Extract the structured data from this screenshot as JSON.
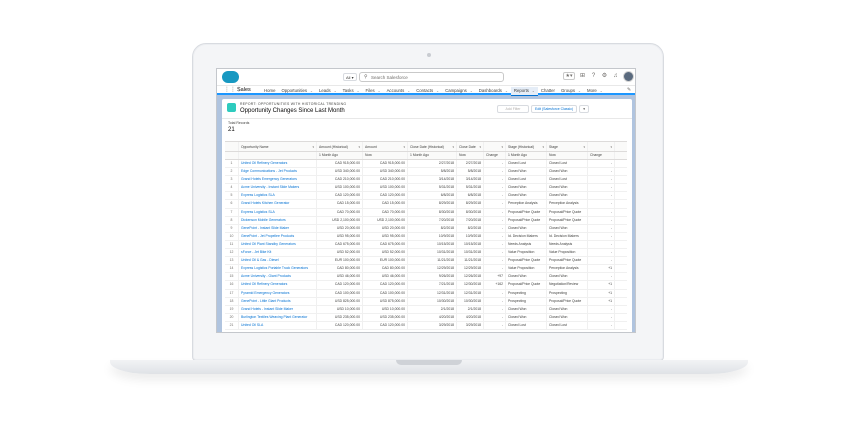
{
  "topbar": {
    "scope": "All",
    "search_placeholder": "Search Salesforce"
  },
  "nav": {
    "app_name": "Sales",
    "items": [
      {
        "label": "Home",
        "has_menu": false
      },
      {
        "label": "Opportunities",
        "has_menu": true
      },
      {
        "label": "Leads",
        "has_menu": true
      },
      {
        "label": "Tasks",
        "has_menu": true
      },
      {
        "label": "Files",
        "has_menu": true
      },
      {
        "label": "Accounts",
        "has_menu": true
      },
      {
        "label": "Contacts",
        "has_menu": true
      },
      {
        "label": "Campaigns",
        "has_menu": true
      },
      {
        "label": "Dashboards",
        "has_menu": true
      },
      {
        "label": "Reports",
        "has_menu": true,
        "active": true
      },
      {
        "label": "Chatter",
        "has_menu": false
      },
      {
        "label": "Groups",
        "has_menu": true
      },
      {
        "label": "More",
        "has_menu": true
      }
    ]
  },
  "report": {
    "type_label": "REPORT: OPPORTUNITIES WITH HISTORICAL TRENDING",
    "title": "Opportunity Changes Since Last Month",
    "add_filter": "Add Filter",
    "edit_button": "Edit (Salesforce Classic)",
    "total_label": "Total Records",
    "total_value": "21"
  },
  "table": {
    "headers": [
      "Opportunity Name",
      "Amount (Historical)",
      "Amount",
      "Close Date (Historical)",
      "Close Date",
      "",
      "Stage (Historical)",
      "Stage",
      ""
    ],
    "subheaders": [
      "",
      "1 Month Ago",
      "Now",
      "1 Month Ago",
      "Now",
      "Change",
      "1 Month Ago",
      "Now",
      "Change"
    ],
    "rows": [
      [
        "1",
        "United Oil Refinery Generators",
        "CAD 915,000.00",
        "CAD 915,000.00",
        "2/27/2018",
        "2/27/2018",
        "-",
        "Closed Lost",
        "Closed Lost",
        "-"
      ],
      [
        "2",
        "Edge Communications - Jet Products",
        "USD 340,000.00",
        "USD 340,000.00",
        "5/8/2018",
        "5/8/2018",
        "-",
        "Closed Won",
        "Closed Won",
        "-"
      ],
      [
        "3",
        "Grand Hotels Emergency Generators",
        "CAD 210,000.00",
        "CAD 210,000.00",
        "3/14/2018",
        "3/14/2018",
        "-",
        "Closed Lost",
        "Closed Lost",
        "-"
      ],
      [
        "4",
        "Acme University - Instant Slide Makers",
        "USD 100,000.00",
        "USD 100,000.00",
        "5/31/2018",
        "5/31/2018",
        "-",
        "Closed Won",
        "Closed Won",
        "-"
      ],
      [
        "5",
        "Express Logistics SLA",
        "CAD 120,000.00",
        "CAD 120,000.00",
        "6/8/2018",
        "6/8/2018",
        "-",
        "Closed Won",
        "Closed Won",
        "-"
      ],
      [
        "6",
        "Grand Hotels Kitchen Generator",
        "CAD 15,000.00",
        "CAD 15,000.00",
        "8/29/2018",
        "8/29/2018",
        "-",
        "Perception Analysis",
        "Perception Analysis",
        "-"
      ],
      [
        "7",
        "Express Logistics SLA",
        "CAD 70,000.00",
        "CAD 70,000.00",
        "8/30/2018",
        "8/30/2018",
        "-",
        "Proposal/Price Quote",
        "Proposal/Price Quote",
        "-"
      ],
      [
        "8",
        "Dickenson Mobile Generators",
        "USD 2,100,000.00",
        "USD 2,100,000.00",
        "7/20/2018",
        "7/20/2018",
        "-",
        "Proposal/Price Quote",
        "Proposal/Price Quote",
        "-"
      ],
      [
        "9",
        "GenePoint - Instant Slide Maker",
        "USD 20,000.00",
        "USD 20,000.00",
        "8/2/2018",
        "8/2/2018",
        "-",
        "Closed Won",
        "Closed Won",
        "-"
      ],
      [
        "10",
        "GenePoint - Jet Propellee Products",
        "USD 95,000.00",
        "USD 95,000.00",
        "10/9/2018",
        "10/9/2018",
        "-",
        "Id. Decision Makers",
        "Id. Decision Makers",
        "-"
      ],
      [
        "11",
        "United Oil Plant Standby Generators",
        "CAD 675,000.00",
        "CAD 675,000.00",
        "10/15/2018",
        "10/15/2018",
        "-",
        "Needs Analysis",
        "Needs Analysis",
        "-"
      ],
      [
        "12",
        "sForce - Jet Bike Kit",
        "USD 52,000.00",
        "USD 52,000.00",
        "10/31/2018",
        "10/31/2018",
        "-",
        "Value Proposition",
        "Value Proposition",
        "-"
      ],
      [
        "13",
        "United Oil & Gas - Diesel",
        "EUR 100,000.00",
        "EUR 100,000.00",
        "11/21/2018",
        "11/21/2018",
        "-",
        "Proposal/Price Quote",
        "Proposal/Price Quote",
        "-"
      ],
      [
        "14",
        "Express Logistics Portable Truck Generators",
        "CAD 80,000.00",
        "CAD 80,000.00",
        "12/29/2018",
        "12/29/2018",
        "-",
        "Value Proposition",
        "Perception Analysis",
        "+1"
      ],
      [
        "15",
        "Acme University - Giant Products",
        "USD 46,000.00",
        "USD 46,000.00",
        "9/26/2018",
        "12/26/2018",
        "+97",
        "Closed Won",
        "Closed Won",
        "-"
      ],
      [
        "16",
        "United Oil Refinery Generators",
        "CAD 120,000.00",
        "CAD 120,000.00",
        "7/21/2018",
        "12/30/2018",
        "+162",
        "Proposal/Price Quote",
        "Negotiation/Review",
        "+1"
      ],
      [
        "17",
        "Pyramid Emergency Generators",
        "CAD 100,000.00",
        "CAD 100,000.00",
        "12/31/2018",
        "12/31/2018",
        "-",
        "Prospecting",
        "Prospecting",
        "+1"
      ],
      [
        "18",
        "GenePoint - Little Giant Products",
        "USD 825,000.00",
        "USD 875,000.00",
        "10/30/2018",
        "10/30/2018",
        "-",
        "Prospecting",
        "Proposal/Price Quote",
        "+1"
      ],
      [
        "19",
        "Grand Hotels - Instant Slide Maker",
        "USD 10,000.00",
        "USD 10,000.00",
        "2/1/2018",
        "2/1/2018",
        "-",
        "Closed Won",
        "Closed Won",
        "-"
      ],
      [
        "20",
        "Burlington Textiles Weaving Plant Generator",
        "USD 235,000.00",
        "USD 235,000.00",
        "4/20/2018",
        "4/20/2018",
        "-",
        "Closed Won",
        "Closed Won",
        "-"
      ],
      [
        "21",
        "United Oil SLA",
        "CAD 120,000.00",
        "CAD 120,000.00",
        "3/29/2018",
        "3/29/2018",
        "-",
        "Closed Lost",
        "Closed Lost",
        "-"
      ]
    ]
  },
  "colors": {
    "brand_blue": "#1798c1",
    "link": "#0070d2",
    "report_icon": "#2ecbbe",
    "screen_bg": "#b0c4df"
  }
}
